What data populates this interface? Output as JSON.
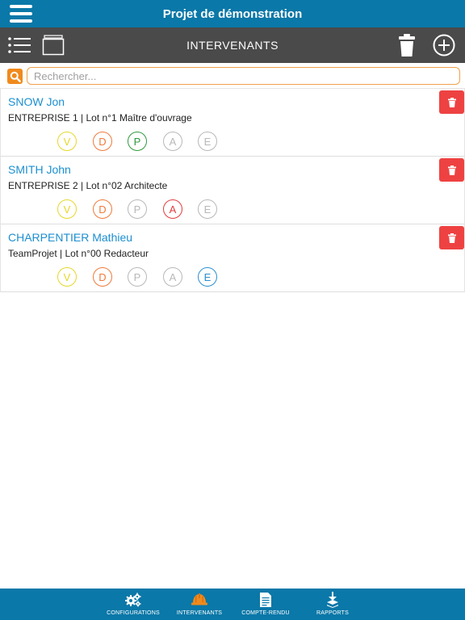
{
  "header": {
    "title": "Projet de démonstration"
  },
  "toolbar": {
    "section_title": "INTERVENANTS"
  },
  "search": {
    "placeholder": "Rechercher..."
  },
  "intervenants": [
    {
      "name": "SNOW Jon",
      "company": "ENTREPRISE 1 | Lot n°1 Maître d'ouvrage",
      "badges": [
        {
          "letter": "V",
          "color": "#e6d72a"
        },
        {
          "letter": "D",
          "color": "#ee7a3b"
        },
        {
          "letter": "P",
          "color": "#2f9a3f"
        },
        {
          "letter": "A",
          "color": "#b8b8b8"
        },
        {
          "letter": "E",
          "color": "#b8b8b8"
        }
      ]
    },
    {
      "name": "SMITH John",
      "company": "ENTREPRISE 2 | Lot n°02 Architecte",
      "badges": [
        {
          "letter": "V",
          "color": "#e6d72a"
        },
        {
          "letter": "D",
          "color": "#ee7a3b"
        },
        {
          "letter": "P",
          "color": "#b8b8b8"
        },
        {
          "letter": "A",
          "color": "#e43b3b"
        },
        {
          "letter": "E",
          "color": "#b8b8b8"
        }
      ]
    },
    {
      "name": "CHARPENTIER Mathieu",
      "company": "TeamProjet | Lot n°00 Redacteur",
      "badges": [
        {
          "letter": "V",
          "color": "#e6d72a"
        },
        {
          "letter": "D",
          "color": "#ee7a3b"
        },
        {
          "letter": "P",
          "color": "#b8b8b8"
        },
        {
          "letter": "A",
          "color": "#b8b8b8"
        },
        {
          "letter": "E",
          "color": "#2b8fd0"
        }
      ]
    }
  ],
  "bottom_nav": {
    "items": [
      {
        "label": "CONFIGURATIONS",
        "icon": "gears-icon"
      },
      {
        "label": "INTERVENANTS",
        "icon": "hard-hat-icon",
        "active": true
      },
      {
        "label": "COMPTE-RENDU",
        "icon": "document-icon"
      },
      {
        "label": "RAPPORTS",
        "icon": "reports-icon"
      }
    ]
  },
  "colors": {
    "primary": "#0a78a8",
    "toolbar": "#4a4a4a",
    "search_accent": "#f08a1c",
    "delete": "#ee4242",
    "name_link": "#1c8fd0",
    "active_nav_icon": "#f08a1c"
  }
}
